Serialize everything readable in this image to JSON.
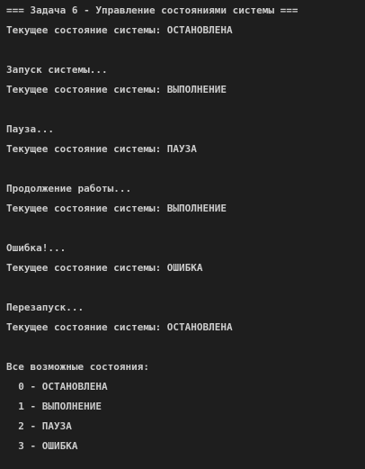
{
  "console": {
    "lines": [
      "=== Задача 6 - Управление состояниями системы ===",
      "Текущее состояние системы: ОСТАНОВЛЕНА",
      "",
      "Запуск системы...",
      "Текущее состояние системы: ВЫПОЛНЕНИЕ",
      "",
      "Пауза...",
      "Текущее состояние системы: ПАУЗА",
      "",
      "Продолжение работы...",
      "Текущее состояние системы: ВЫПОЛНЕНИЕ",
      "",
      "Ошибка!...",
      "Текущее состояние системы: ОШИБКА",
      "",
      "Перезапуск...",
      "Текущее состояние системы: ОСТАНОВЛЕНА",
      "",
      "Все возможные состояния:",
      "  0 - ОСТАНОВЛЕНА",
      "  1 - ВЫПОЛНЕНИЕ",
      "  2 - ПАУЗА",
      "  3 - ОШИБКА"
    ]
  }
}
